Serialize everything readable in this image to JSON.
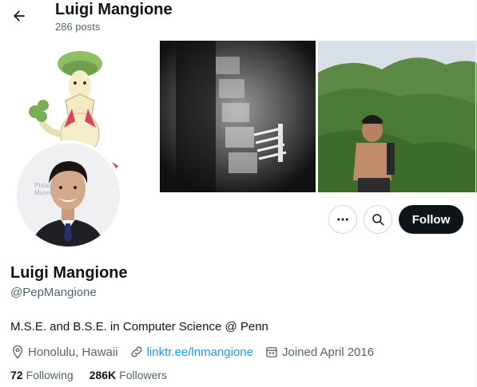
{
  "header": {
    "title": "Luigi Mangione",
    "post_count": "286 posts"
  },
  "profile": {
    "name": "Luigi Mangione",
    "handle": "@PepMangione",
    "bio": "M.S.E. and B.S.E. in Computer Science @ Penn",
    "location": "Honolulu, Hawaii",
    "website": "linktr.ee/lnmangione",
    "joined": "Joined April 2016",
    "following_count": "72",
    "following_label": "Following",
    "followers_count": "286K",
    "followers_label": "Followers"
  },
  "actions": {
    "follow_label": "Follow"
  },
  "icons": {
    "back": "arrow-left-icon",
    "more": "more-dots-icon",
    "search": "search-icon",
    "location": "location-pin-icon",
    "link": "link-icon",
    "calendar": "calendar-icon"
  },
  "colors": {
    "accent": "#1d9bf0",
    "text_primary": "#0f1419",
    "text_secondary": "#536471",
    "follow_button": "#0f1419"
  }
}
